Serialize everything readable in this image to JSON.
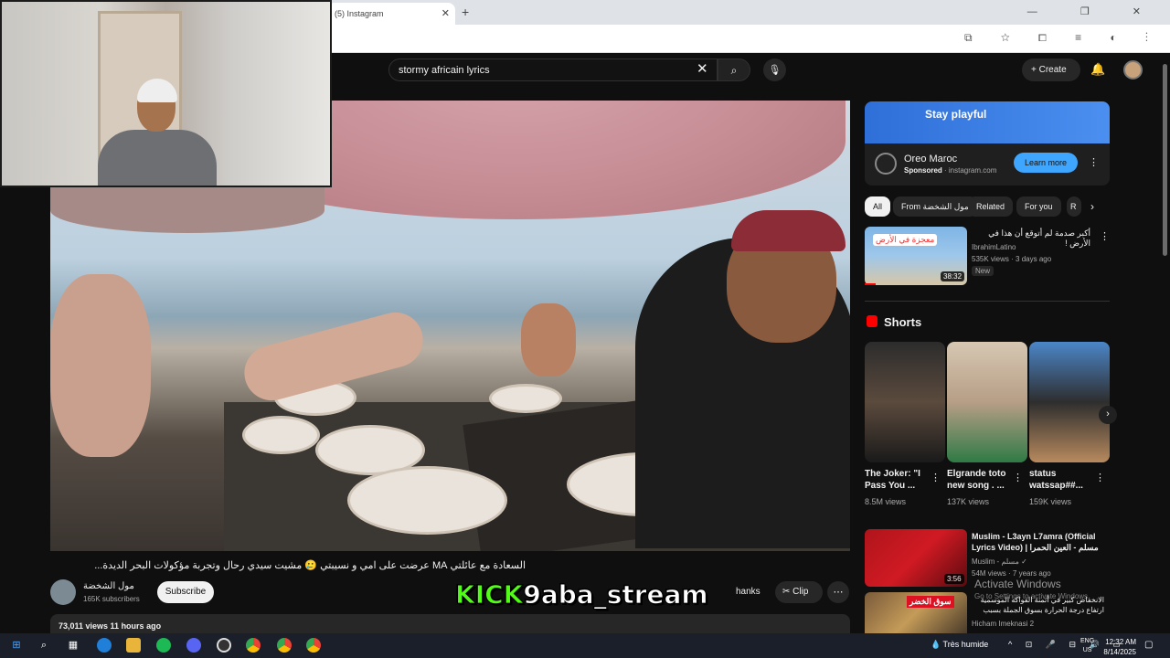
{
  "browser": {
    "tab_title": "(5) Instagram",
    "tab_close": "✕",
    "new_tab": "+",
    "window_controls": "— ❐ ✕",
    "addr_icons": "⧉ ☆ ⧠ ≡ ◐ ⋮"
  },
  "header": {
    "search_value": "stormy africain lyrics",
    "clear_icon": "✕",
    "search_icon": "⌕",
    "mic_icon": "🎙",
    "create_label": "+ Create",
    "bell_icon": "🔔"
  },
  "video": {
    "title": "السعادة مع عائلتي MA عرضت على امي و نسيبتي 🥲 مشيت سيدي رحال وتجربة مؤكولات البحر الديدة...",
    "channel_name": "مول الشخضة",
    "channel_subs": "165K subscribers",
    "subscribe_label": "Subscribe",
    "overlay_brand": "KICK",
    "overlay_handle": "9aba_stream",
    "thanks_label": "hanks",
    "clip_label": "✂ Clip",
    "more_label": "⋯",
    "views_time": "73,011 views  11 hours ago"
  },
  "ad": {
    "banner_text": "Stay playful",
    "advertiser": "Oreo Maroc",
    "sponsored": "Sponsored",
    "domain": " · instagram.com",
    "cta": "Learn more",
    "more_icon": "⋮"
  },
  "chips": [
    {
      "label": "All"
    },
    {
      "label": "From مول الشخضة"
    },
    {
      "label": "Related"
    },
    {
      "label": "For you"
    },
    {
      "label": "R"
    }
  ],
  "chip_next": "›",
  "recommended": {
    "thumb_label": "معجزة في الأرض",
    "duration": "38:32",
    "title": "أكبر صدمة لم أتوقع أن هذا في الأرض !",
    "channel": "IbrahimLatino",
    "meta": "535K views · 3 days ago",
    "badge": "New",
    "more_icon": "⋮"
  },
  "shorts": {
    "heading": "Shorts",
    "next_icon": "›",
    "items": [
      {
        "title": "The Joker: \"I Pass You ...",
        "views": "8.5M views"
      },
      {
        "title": "Elgrande toto new song . ...",
        "views": "137K views"
      },
      {
        "title": "status watssap##...",
        "views": "159K views"
      }
    ],
    "more_icon": "⋮"
  },
  "video2": {
    "title": "Muslim - L3ayn L7amra (Official Lyrics Video) | مسلم - العين الحمرا",
    "channel": "Muslim - مسلم ✓",
    "meta": "54M views · 7 years ago",
    "duration": "3:56"
  },
  "video3": {
    "thumb_label": "سوق الخضر",
    "title": "الانخفاض كبير في أثمنة الفواكه الموسمية ارتفاع درجة الحرارة بسوق الجملة بسبب",
    "channel": "Hicham Imeknasi 2"
  },
  "watermark": {
    "line1": "Activate Windows",
    "line2": "Go to Settings to activate Windows."
  },
  "taskbar": {
    "weather": "💧 Très humide",
    "tray": "^ ⊡ 🎤 ⊟ 🔊 ▭",
    "lang_line1": "ENG",
    "lang_line2": "US",
    "time": "12:32 AM",
    "date": "8/14/2025",
    "notif_icon": "▢"
  },
  "colors": {
    "accent_blue": "#3ea6ff",
    "subscribe_bg": "#f1f1f1",
    "kick_green": "#53fc18",
    "yt_red": "#ff0000"
  }
}
